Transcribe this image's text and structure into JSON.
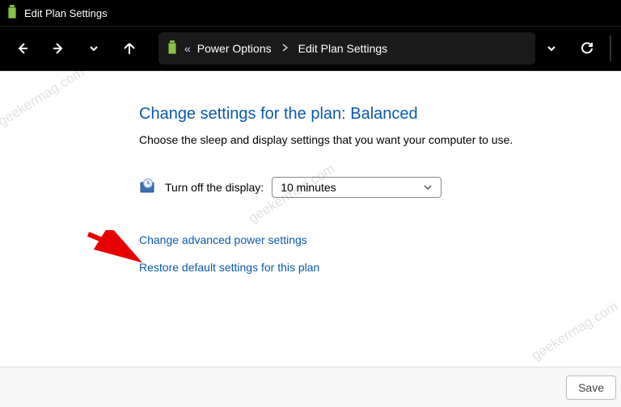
{
  "titlebar": {
    "title": "Edit Plan Settings"
  },
  "toolbar": {
    "breadcrumb_prefix": "«",
    "breadcrumb1": "Power Options",
    "breadcrumb2": "Edit Plan Settings"
  },
  "content": {
    "heading": "Change settings for the plan: Balanced",
    "subtext": "Choose the sleep and display settings that you want your computer to use.",
    "display_row": {
      "label": "Turn off the display:",
      "value": "10 minutes"
    },
    "link_advanced": "Change advanced power settings",
    "link_restore": "Restore default settings for this plan"
  },
  "footer": {
    "save_label": "Save"
  },
  "watermark": "geekermag.com"
}
